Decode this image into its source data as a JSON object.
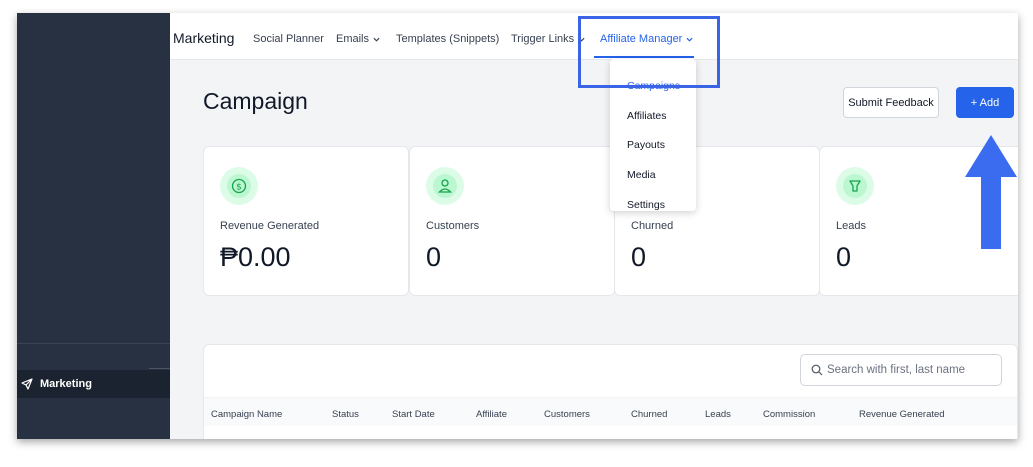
{
  "colors": {
    "accent": "#2563eb",
    "sidebar": "#283142",
    "highlight_box": "#3b63e6",
    "arrow": "#3b6cf0",
    "icon_green": "#22c55e"
  },
  "sidebar": {
    "active_item": {
      "label": "Marketing",
      "icon": "paper-plane-icon"
    }
  },
  "topbar": {
    "brand": "Marketing",
    "nav": [
      {
        "label": "Social Planner",
        "has_chevron": false
      },
      {
        "label": "Emails",
        "has_chevron": true
      },
      {
        "label": "Templates (Snippets)",
        "has_chevron": false
      },
      {
        "label": "Trigger Links",
        "has_chevron": true
      },
      {
        "label": "Affiliate Manager",
        "has_chevron": true,
        "active": true
      }
    ]
  },
  "dropdown": {
    "items": [
      "Campaigns",
      "Affiliates",
      "Payouts",
      "Media",
      "Settings"
    ],
    "active": "Campaigns"
  },
  "page": {
    "title": "Campaign",
    "feedback_button": "Submit Feedback",
    "add_button": "+ Add"
  },
  "stats": [
    {
      "label": "Revenue Generated",
      "value": "₱0.00",
      "icon": "dollar-icon"
    },
    {
      "label": "Customers",
      "value": "0",
      "icon": "user-icon"
    },
    {
      "label": "Churned",
      "value": "0",
      "icon": "churn-icon"
    },
    {
      "label": "Leads",
      "value": "0",
      "icon": "lead-icon"
    }
  ],
  "table": {
    "search_placeholder": "Search with first, last name",
    "columns": [
      "Campaign Name",
      "Status",
      "Start Date",
      "Affiliate",
      "Customers",
      "Churned",
      "Leads",
      "Commission",
      "Revenue Generated"
    ]
  }
}
